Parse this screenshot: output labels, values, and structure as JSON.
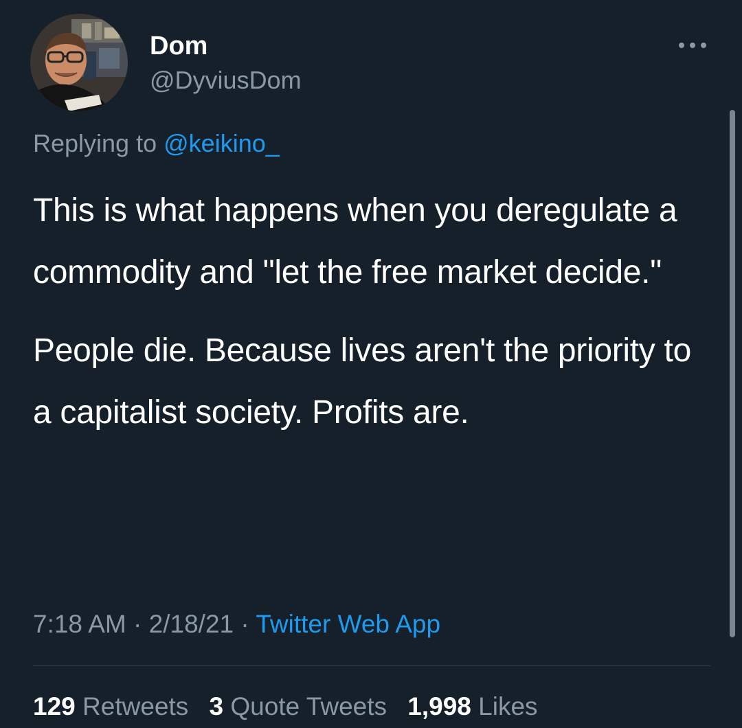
{
  "tweet": {
    "author": {
      "display_name": "Dom",
      "handle": "@DyviusDom",
      "avatar_icon": "user-avatar-photo"
    },
    "more_icon": "more-horizontal-icon",
    "reply": {
      "prefix": "Replying to",
      "target": "@keikino_"
    },
    "paragraphs": [
      "This is what happens when you deregulate a commodity and \"let the free market decide.\"",
      "People die. Because lives aren't the priority to a capitalist society. Profits are."
    ],
    "meta": {
      "time": "7:18 AM",
      "separator": "·",
      "date": "2/18/21",
      "source": "Twitter Web App"
    },
    "stats": {
      "retweets_count": "129",
      "retweets_label": "Retweets",
      "quotes_count": "3",
      "quotes_label": "Quote Tweets",
      "likes_count": "1,998",
      "likes_label": "Likes"
    }
  },
  "colors": {
    "background": "#15202b",
    "primary_text": "#ffffff",
    "secondary_text": "#8b98a5",
    "link": "#1d9bf0",
    "divider": "#38444d"
  }
}
